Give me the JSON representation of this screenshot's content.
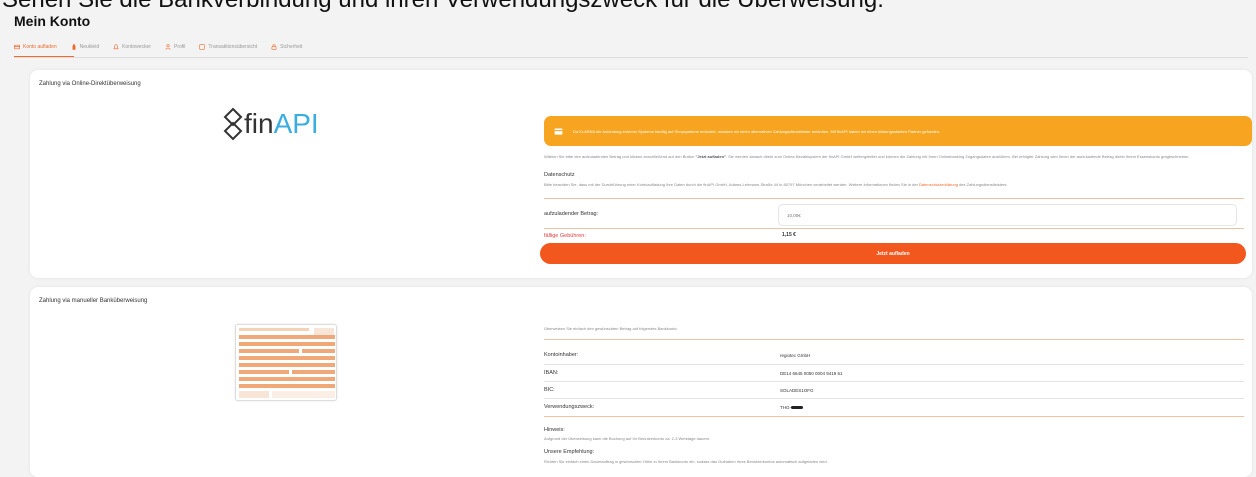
{
  "caption": "Sehen Sie die Bankverbindung und ihren Verwendungszweck für die Überweisung.",
  "page_title": "Mein Konto",
  "tabs": [
    {
      "label": "Konto aufladen",
      "icon": "card-icon",
      "active": true
    },
    {
      "label": "Neukleid",
      "icon": "bottle-icon",
      "active": false
    },
    {
      "label": "Kontowecker",
      "icon": "bell-icon",
      "active": false
    },
    {
      "label": "Profil",
      "icon": "user-icon",
      "active": false
    },
    {
      "label": "Transaktionsübersicht",
      "icon": "list-icon",
      "active": false
    },
    {
      "label": "Sicherheit",
      "icon": "lock-icon",
      "active": false
    }
  ],
  "online": {
    "title": "Zahlung via Online-Direktüberweisung",
    "logo_left": "fin",
    "logo_right": "API",
    "notice": "Da KLARNA die Anbindung externer Systeme künftig auf Shopsysteme reduziert, mussten wir einen alternativen Zahlungsdienstleister anbinden. Mit finAPI haben wir einen leistungsstarken Partner gefunden.",
    "description_prefix": "Wählen Sie bitte den aufzuladenden Betrag und klicken anschließend auf den Button ",
    "description_button": "\"Jetzt aufladen\"",
    "description_suffix": ". Sie werden danach direkt zum Online-Bezahlsystem der finAPI GmbH weitergeleitet und können die Zahlung mit Ihren Onlinebanking Zugangsdaten ausführen. Bei erfolgter Zahlung wird Ihnen der aufzuladende Betrag direkt Ihrem Essenskonto gutgeschrieben.",
    "privacy_heading": "Datenschutz",
    "privacy_text": "Bitte beachten Sie, dass mit der Durchführung einer Kontoaufladung Ihre Daten durch die finAPI GmbH, Adams-Lehmann-Straße 44 in 80797 München verarbeitet werden. Weitere Informationen finden Sie in der ",
    "privacy_link": "Datenschutzerklärung",
    "privacy_suffix": " des Zahlungsdienstleisters.",
    "amount_label": "aufzuladender Betrag:",
    "amount_value": "10,00€",
    "fee_label": "fällige Gebühren:",
    "fee_value": "1,15 €",
    "button": "Jetzt aufladen"
  },
  "manual": {
    "title": "Zahlung via manueller Banküberweisung",
    "intro": "Überweisen Sie einfach den gewünschten Betrag auf folgendes Bankkonto:",
    "rows": [
      {
        "label": "Kontoinhaber:",
        "value": "regiotec GmbH"
      },
      {
        "label": "IBAN:",
        "value": "DE14 6645 0050 0004 9419 61"
      },
      {
        "label": "BIC:",
        "value": "SOLADES1OFG"
      },
      {
        "label": "Verwendungszweck:",
        "value": "THG-"
      }
    ],
    "hint_heading": "Hinweis:",
    "hint_text": "Aufgrund der Überweisung kann die Buchung auf Ihr Benutzerkonto ca. 2-3 Werktage dauern.",
    "recommendation_heading": "Unsere Empfehlung:",
    "recommendation_text": "Richten Sie einfach einen Dauerauftrag in gewünschter Höhe in Ihrem Bankkonto ein, sodass das Guthaben Ihres Benutzerkontos automatisch aufgeladen wird."
  },
  "colors": {
    "accent": "#f06a2a",
    "notice": "#f7a520",
    "button": "#f2571e",
    "api_blue": "#3aaee0"
  }
}
